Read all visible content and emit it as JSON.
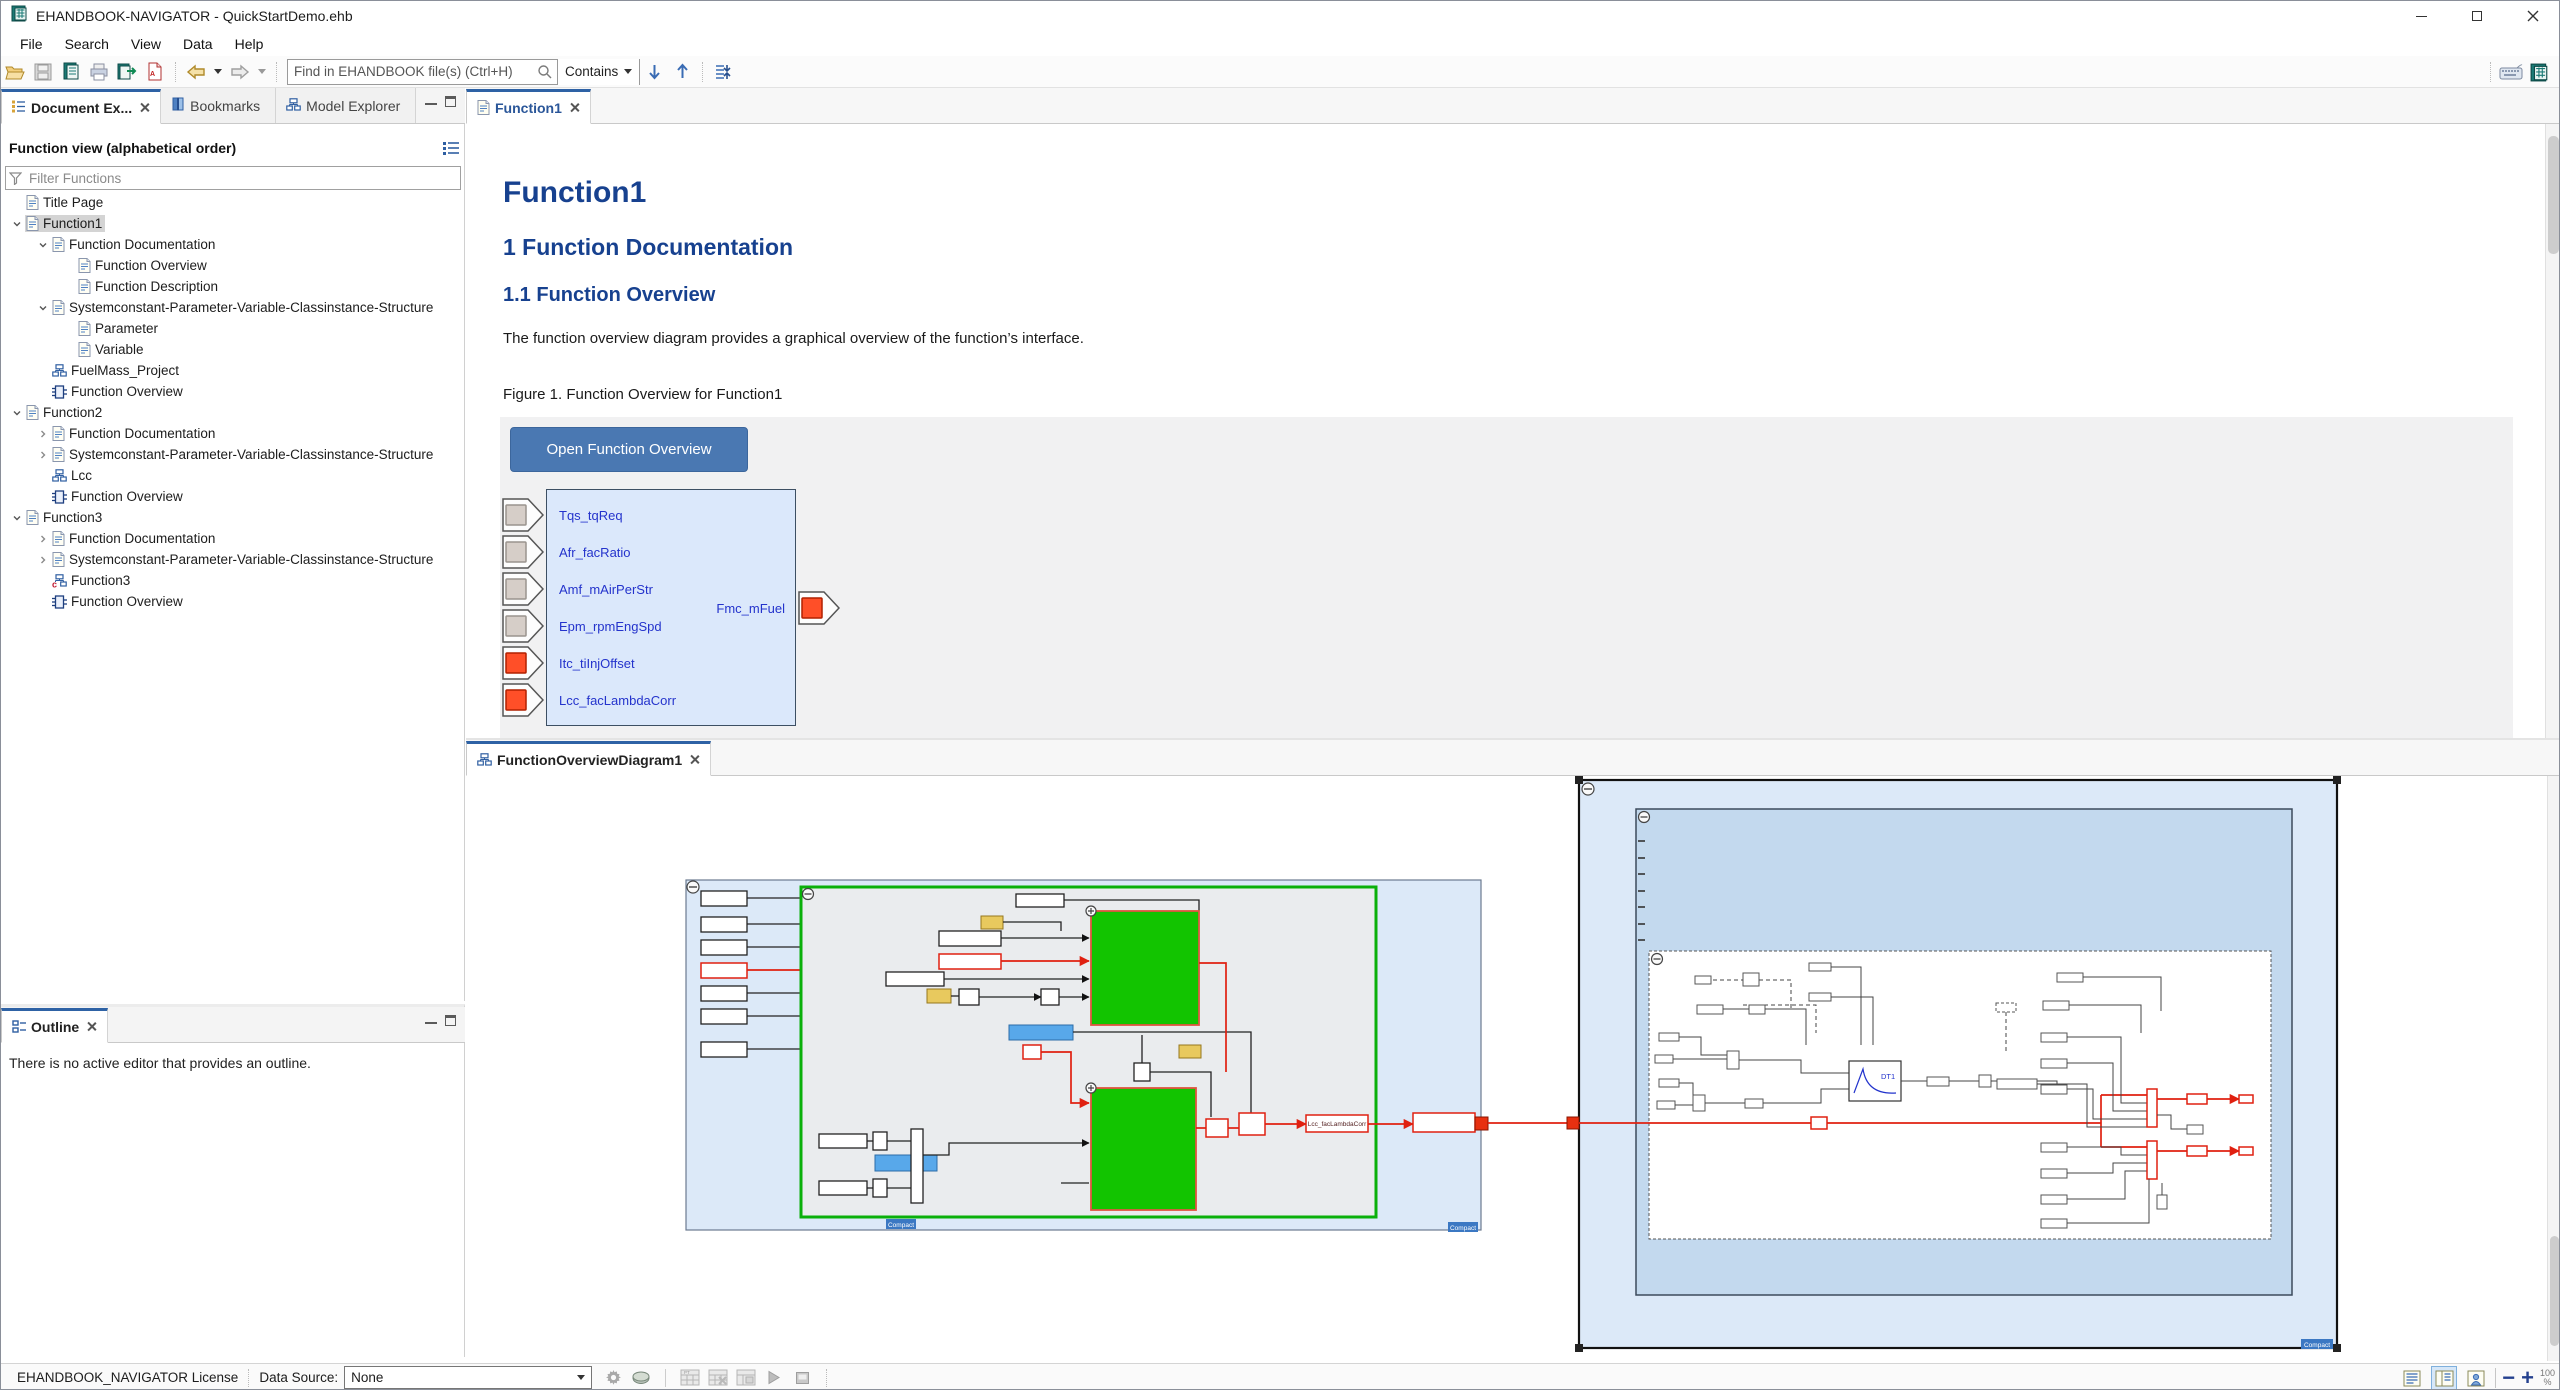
{
  "window": {
    "title": "EHANDBOOK-NAVIGATOR - QuickStartDemo.ehb"
  },
  "menu": {
    "items": [
      "File",
      "Search",
      "View",
      "Data",
      "Help"
    ]
  },
  "toolbar": {
    "find_placeholder": "Find in EHANDBOOK file(s) (Ctrl+H)",
    "contains_label": "Contains"
  },
  "left_panel": {
    "tabs": [
      {
        "label": "Document Ex...",
        "icon": "document-explorer",
        "active": true,
        "closable": true
      },
      {
        "label": "Bookmarks",
        "icon": "bookmarks",
        "active": false,
        "closable": false
      },
      {
        "label": "Model Explorer",
        "icon": "model-explorer",
        "active": false,
        "closable": false
      }
    ],
    "view_title": "Function view (alphabetical order)",
    "filter_placeholder": "Filter Functions",
    "tree": [
      {
        "label": "Title Page",
        "level": 1,
        "icon": "doc",
        "arrow": "none",
        "selected": false
      },
      {
        "label": "Function1",
        "level": 1,
        "icon": "doc",
        "arrow": "down",
        "selected": true
      },
      {
        "label": "Function Documentation",
        "level": 2,
        "icon": "doc",
        "arrow": "down",
        "selected": false
      },
      {
        "label": "Function Overview",
        "level": 3,
        "icon": "doc",
        "arrow": "none",
        "selected": false
      },
      {
        "label": "Function Description",
        "level": 3,
        "icon": "doc",
        "arrow": "none",
        "selected": false
      },
      {
        "label": "Systemconstant-Parameter-Variable-Classinstance-Structure",
        "level": 2,
        "icon": "doc",
        "arrow": "down",
        "selected": false
      },
      {
        "label": "Parameter",
        "level": 3,
        "icon": "doc",
        "arrow": "none",
        "selected": false
      },
      {
        "label": "Variable",
        "level": 3,
        "icon": "doc",
        "arrow": "none",
        "selected": false
      },
      {
        "label": "FuelMass_Project",
        "level": 2,
        "icon": "model",
        "arrow": "none",
        "selected": false
      },
      {
        "label": "Function Overview",
        "level": 2,
        "icon": "overview",
        "arrow": "none",
        "selected": false
      },
      {
        "label": "Function2",
        "level": 1,
        "icon": "doc",
        "arrow": "down",
        "selected": false
      },
      {
        "label": "Function Documentation",
        "level": 2,
        "icon": "doc",
        "arrow": "right",
        "selected": false
      },
      {
        "label": "Systemconstant-Parameter-Variable-Classinstance-Structure",
        "level": 2,
        "icon": "doc",
        "arrow": "right",
        "selected": false
      },
      {
        "label": "Lcc",
        "level": 2,
        "icon": "model",
        "arrow": "none",
        "selected": false
      },
      {
        "label": "Function Overview",
        "level": 2,
        "icon": "overview",
        "arrow": "none",
        "selected": false
      },
      {
        "label": "Function3",
        "level": 1,
        "icon": "doc",
        "arrow": "down",
        "selected": false
      },
      {
        "label": "Function Documentation",
        "level": 2,
        "icon": "doc",
        "arrow": "right",
        "selected": false
      },
      {
        "label": "Systemconstant-Parameter-Variable-Classinstance-Structure",
        "level": 2,
        "icon": "doc",
        "arrow": "right",
        "selected": false
      },
      {
        "label": "Function3",
        "level": 2,
        "icon": "model-c",
        "arrow": "none",
        "selected": false
      },
      {
        "label": "Function Overview",
        "level": 2,
        "icon": "overview",
        "arrow": "none",
        "selected": false
      }
    ]
  },
  "outline": {
    "tab_label": "Outline",
    "message": "There is no active editor that provides an outline."
  },
  "doc_editor": {
    "tab_label": "Function1",
    "title": "Function1",
    "section1": "1 Function Documentation",
    "section11": "1.1 Function Overview",
    "paragraph": "The function overview diagram provides a graphical overview of the function’s interface.",
    "figure_caption": "Figure 1. Function Overview for Function1",
    "open_button": "Open Function Overview",
    "block": {
      "inputs": [
        {
          "name": "Tqs_tqReq",
          "port": "gray"
        },
        {
          "name": "Afr_facRatio",
          "port": "gray"
        },
        {
          "name": "Amf_mAirPerStr",
          "port": "gray"
        },
        {
          "name": "Epm_rpmEngSpd",
          "port": "gray"
        },
        {
          "name": "Itc_tiInjOffset",
          "port": "red"
        },
        {
          "name": "Lcc_facLambdaCorr",
          "port": "red"
        }
      ],
      "output": {
        "name": "Fmc_mFuel",
        "port": "red"
      }
    }
  },
  "diagram_editor": {
    "tab_label": "FunctionOverviewDiagram1",
    "labels": {
      "signal_box": "Lcc_facLambdaCorr",
      "compact": "Compact",
      "dt1": "DT1"
    }
  },
  "status_bar": {
    "license": "EHANDBOOK_NAVIGATOR License",
    "data_source_label": "Data Source:",
    "data_source_value": "None",
    "zoom_value": "100",
    "zoom_unit": "%"
  },
  "colors": {
    "accent_blue": "#2e62a5",
    "heading_blue": "#17418f",
    "button_blue": "#4a78b2",
    "block_fill": "#dbe8fb",
    "block_label_blue": "#2433cc",
    "port_red": "#ff4f28",
    "port_gray": "#d6cec8",
    "green_block": "#12c400",
    "container_blue": "#dce9f8",
    "mid_container_blue": "#c3d9ee",
    "wire_red": "#e02010"
  }
}
